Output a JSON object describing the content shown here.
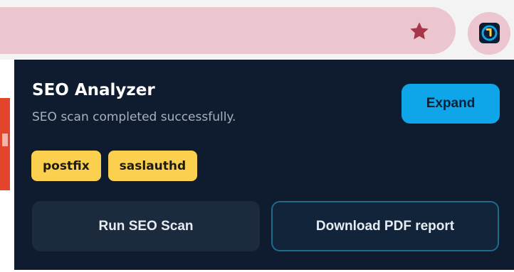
{
  "browser": {
    "omnibox_color": "#ecc6ce",
    "bookmark_icon": "star-icon",
    "extension_icon": "seo-analyzer-extension-icon"
  },
  "popup": {
    "title": "SEO Analyzer",
    "status": "SEO scan completed successfully.",
    "expand_label": "Expand",
    "tags": [
      "postfix",
      "saslauthd"
    ],
    "run_scan_label": "Run SEO Scan",
    "download_label": "Download PDF report"
  },
  "colors": {
    "popup_bg": "#0f1b2e",
    "accent": "#0ea5e9",
    "tag_bg": "#fcd04f",
    "star": "#a8364b"
  }
}
